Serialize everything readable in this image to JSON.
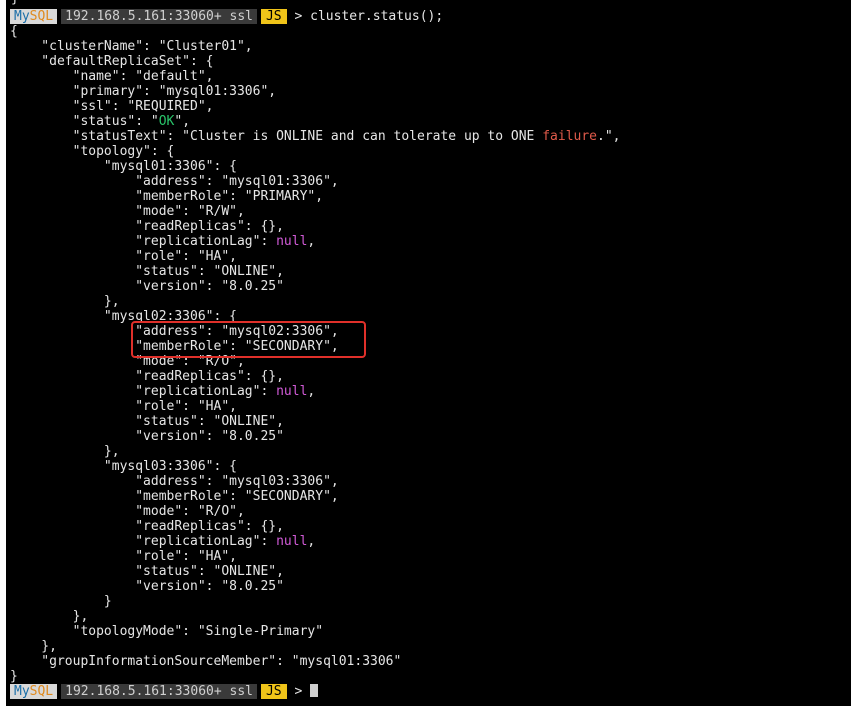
{
  "prompt": {
    "app": "My",
    "app_accent": "SQL",
    "host": "192.168.5.161:33060+ ssl",
    "mode": "JS",
    "caret": ">"
  },
  "command": "cluster.status();",
  "top_glyph": "}",
  "output": {
    "open_brace": "{",
    "cluster_name": "    \"clusterName\": \"Cluster01\",",
    "default_replica_set": "    \"defaultReplicaSet\": {",
    "name": "        \"name\": \"default\",",
    "primary": "        \"primary\": \"mysql01:3306\",",
    "ssl": "        \"ssl\": \"REQUIRED\",",
    "status_pre": "        \"status\": \"",
    "status_val": "OK",
    "status_post": "\",",
    "status_text_pre": "        \"statusText\": \"Cluster is ONLINE and can tolerate up to ONE ",
    "status_text_val": "failure",
    "status_text_post": ".\",",
    "topology": "        \"topology\": {",
    "members": [
      {
        "header": "            \"mysql01:3306\": {",
        "address": "                \"address\": \"mysql01:3306\",",
        "member_role": "                \"memberRole\": \"PRIMARY\",",
        "mode": "                \"mode\": \"R/W\",",
        "read_replicas": "                \"readReplicas\": {},",
        "lag_pre": "                \"replicationLag\": ",
        "lag_val": "null",
        "lag_post": ",",
        "role": "                \"role\": \"HA\",",
        "status": "                \"status\": \"ONLINE\",",
        "version": "                \"version\": \"8.0.25\"",
        "close": "            },"
      },
      {
        "header": "            \"mysql02:3306\": {",
        "address": "                \"address\": \"mysql02:3306\",",
        "member_role": "                \"memberRole\": \"SECONDARY\",",
        "mode": "                \"mode\": \"R/O\",",
        "read_replicas": "                \"readReplicas\": {},",
        "lag_pre": "                \"replicationLag\": ",
        "lag_val": "null",
        "lag_post": ",",
        "role": "                \"role\": \"HA\",",
        "status": "                \"status\": \"ONLINE\",",
        "version": "                \"version\": \"8.0.25\"",
        "close": "            },"
      },
      {
        "header": "            \"mysql03:3306\": {",
        "address": "                \"address\": \"mysql03:3306\",",
        "member_role": "                \"memberRole\": \"SECONDARY\",",
        "mode": "                \"mode\": \"R/O\",",
        "read_replicas": "                \"readReplicas\": {},",
        "lag_pre": "                \"replicationLag\": ",
        "lag_val": "null",
        "lag_post": ",",
        "role": "                \"role\": \"HA\",",
        "status": "                \"status\": \"ONLINE\",",
        "version": "                \"version\": \"8.0.25\"",
        "close": "            }"
      }
    ],
    "topology_close": "        },",
    "topology_mode": "        \"topologyMode\": \"Single-Primary\"",
    "replica_set_close": "    },",
    "group_info": "    \"groupInformationSourceMember\": \"mysql01:3306\"",
    "close_brace": "}"
  },
  "colors": {
    "terminal_bg": "#000000",
    "text": "#e6e6e6",
    "null_keyword": "#d25bd8",
    "ok_keyword": "#29c46a",
    "failure_keyword": "#e05a4a",
    "prompt_js_bg": "#f0c419",
    "highlight_border": "#e0302a"
  }
}
